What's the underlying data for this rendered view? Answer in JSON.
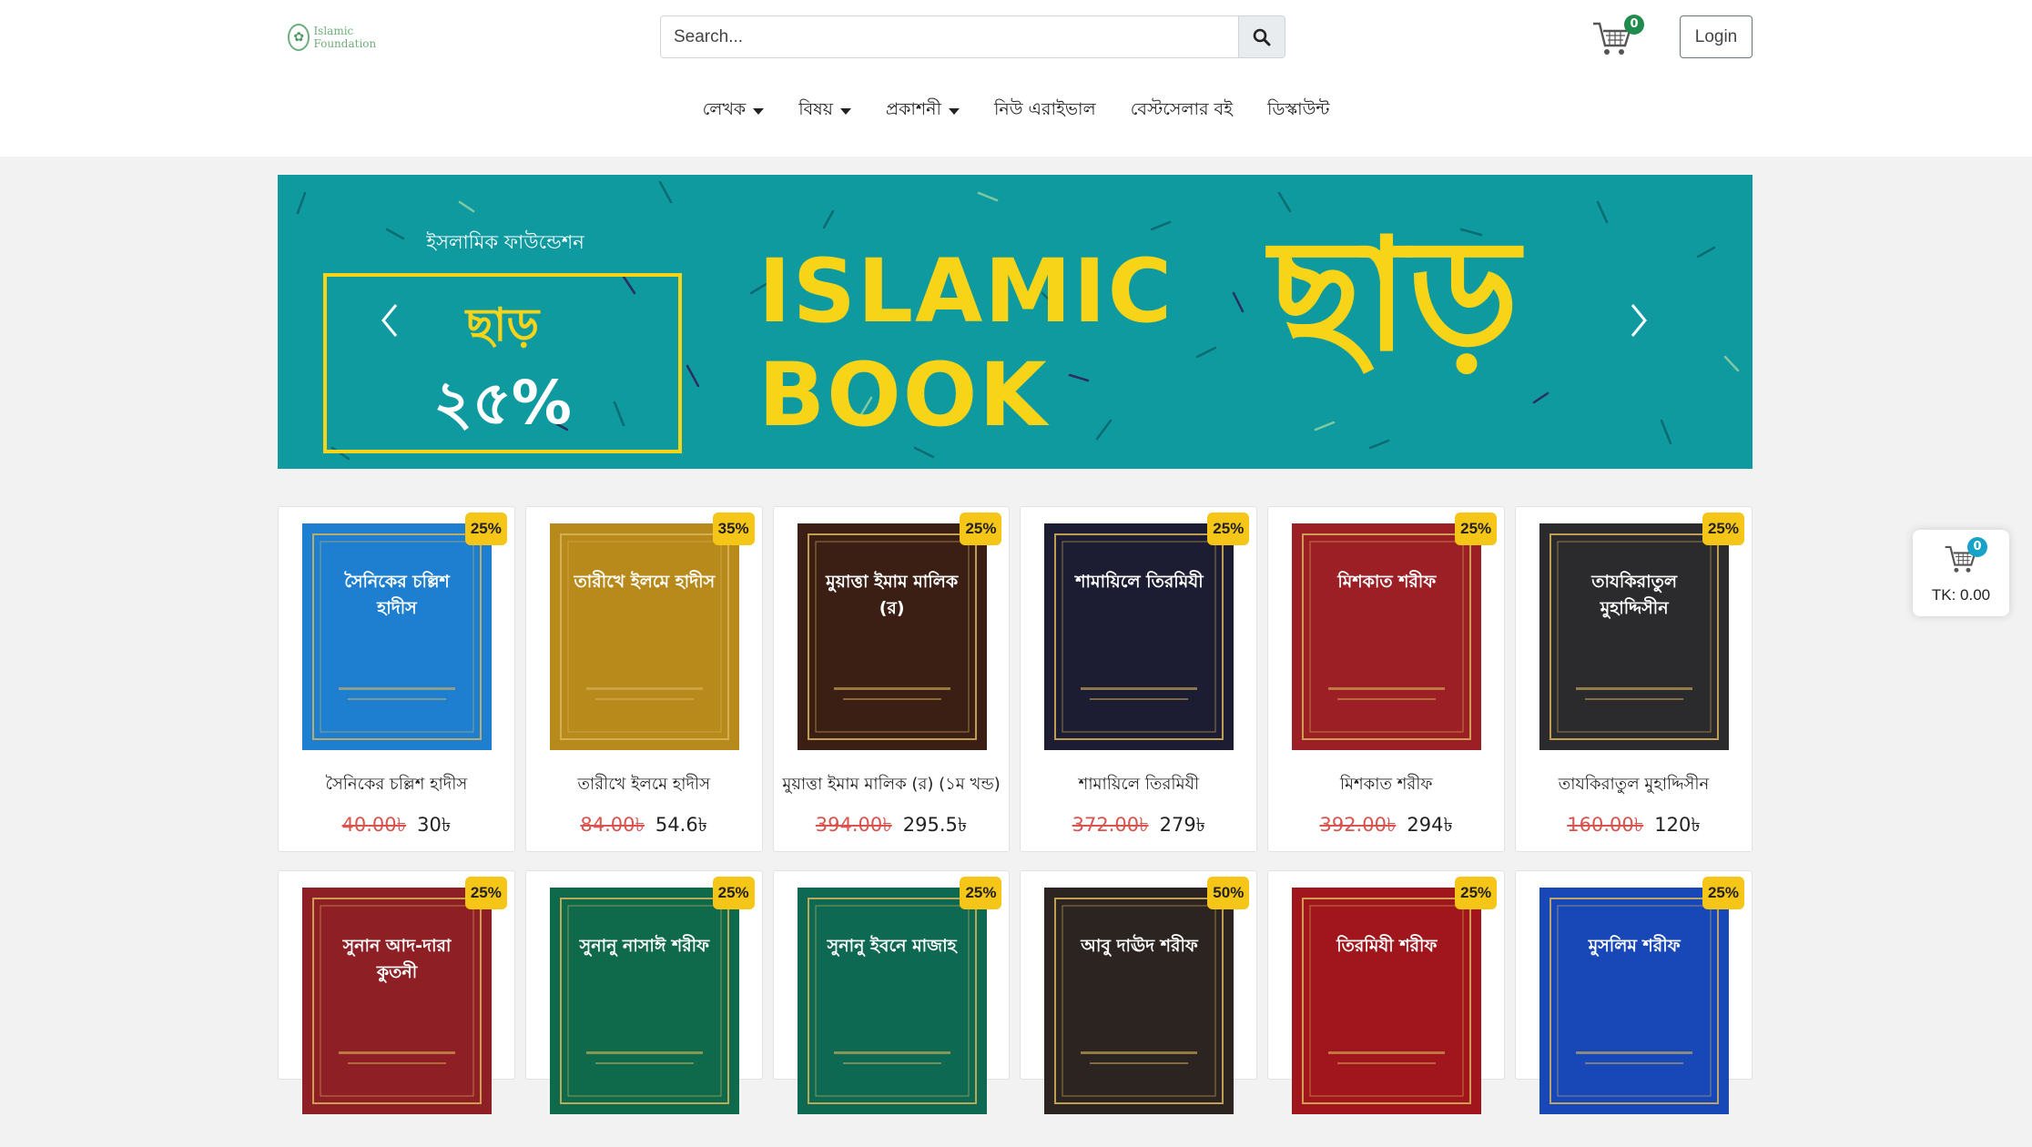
{
  "header": {
    "logo_text": "Islamic Foundation",
    "search_placeholder": "Search...",
    "cart_count": "0",
    "login_label": "Login"
  },
  "nav": [
    {
      "label": "লেখক",
      "dropdown": true
    },
    {
      "label": "বিষয়",
      "dropdown": true
    },
    {
      "label": "প্রকাশনী",
      "dropdown": true
    },
    {
      "label": "নিউ এরাইভাল",
      "dropdown": false
    },
    {
      "label": "বেস্টসেলার বই",
      "dropdown": false
    },
    {
      "label": "ডিস্কাউন্ট",
      "dropdown": false
    }
  ],
  "banner": {
    "org": "ইসলামিক ফাউন্ডেশন",
    "offer_word": "ছাড়",
    "offer_pct": "২৫%",
    "headline_1": "ISLAMIC",
    "headline_2": "BOOK",
    "big_word": "ছাড়",
    "colors": {
      "background": "#0f9aa0",
      "accent": "#f7d417"
    }
  },
  "products_row1": [
    {
      "title": "সৈনিকের চল্লিশ হাদীস",
      "old_price": "40.00৳",
      "new_price": "30৳",
      "discount": "25%",
      "cover_color": "#1e7fd0",
      "cover_text": "সৈনিকের চল্লিশ হাদীস"
    },
    {
      "title": "তারীখে ইলমে হাদীস",
      "old_price": "84.00৳",
      "new_price": "54.6৳",
      "discount": "35%",
      "cover_color": "#b88a1c",
      "cover_text": "তারীখে ইলমে হাদীস"
    },
    {
      "title": "মুয়াত্তা ইমাম মালিক (র) (১ম খন্ড)",
      "old_price": "394.00৳",
      "new_price": "295.5৳",
      "discount": "25%",
      "cover_color": "#3b1f14",
      "cover_text": "মুয়াত্তা ইমাম মালিক (র)"
    },
    {
      "title": "শামায়িলে তিরমিযী",
      "old_price": "372.00৳",
      "new_price": "279৳",
      "discount": "25%",
      "cover_color": "#1c1d33",
      "cover_text": "শামায়িলে তিরমিযী"
    },
    {
      "title": "মিশকাত শরীফ",
      "old_price": "392.00৳",
      "new_price": "294৳",
      "discount": "25%",
      "cover_color": "#9c1f25",
      "cover_text": "মিশকাত শরীফ"
    },
    {
      "title": "তাযকিরাতুল মুহাদ্দিসীন",
      "old_price": "160.00৳",
      "new_price": "120৳",
      "discount": "25%",
      "cover_color": "#2b2b2d",
      "cover_text": "তাযকিরাতুল মুহাদ্দিসীন"
    }
  ],
  "products_row2": [
    {
      "discount": "25%",
      "cover_color": "#8e1f24",
      "cover_text": "সুনান আদ-দারা কুতনী"
    },
    {
      "discount": "25%",
      "cover_color": "#0f6a4b",
      "cover_text": "সুনানু নাসাঈ শরীফ"
    },
    {
      "discount": "25%",
      "cover_color": "#0e6952",
      "cover_text": "সুনানু ইবনে মাজাহ"
    },
    {
      "discount": "50%",
      "cover_color": "#2c2420",
      "cover_text": "আবু দাঊদ শরীফ"
    },
    {
      "discount": "25%",
      "cover_color": "#a1161c",
      "cover_text": "তিরমিযী শরীফ"
    },
    {
      "discount": "25%",
      "cover_color": "#1848b8",
      "cover_text": "মুসলিম শরীফ"
    }
  ],
  "floating_cart": {
    "count": "0",
    "total": "TK: 0.00"
  }
}
